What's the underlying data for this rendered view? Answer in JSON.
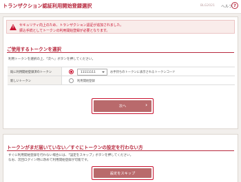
{
  "header": {
    "title": "トランザクション認証利用開始登録選択",
    "screen_id": "BLG2021",
    "help_label": "ヘルプ",
    "help_icon": "?"
  },
  "alert": {
    "icon": "!",
    "line1": "セキュリティ向上のため、トランザクション認証が追加されました。",
    "line2": "振込手続としてトークンの利用開始登録が必要となります。"
  },
  "select_token": {
    "title": "ご使用するトークンを選択",
    "instruction": "利用トークンを選択の上、「次へ」ボタンを押してください。",
    "rows": [
      {
        "label": "既に利用開始登録済のトークン",
        "select_value": "11111111",
        "note": "お手持ちのトークンに表示されるトークンコード",
        "checked": true
      },
      {
        "label": "新しいトークン",
        "option_label": "利用開始登録",
        "checked": false
      }
    ],
    "next_button": "次へ",
    "next_chevron": "›"
  },
  "no_token": {
    "title": "トークンがまだ届いていない／すぐにトークンの設定を行わない方",
    "instruction1": "すぐに利用開始登録を行わない場合には、「設定をスキップ」ボタンを押してください。",
    "instruction2": "なお、次回ログイン時に改めて利用開始登録が可能です。",
    "skip_button": "設定をスキップ"
  },
  "colors": {
    "brand": "#b7273c",
    "alert_text": "#c8102e",
    "button": "#b96a6c"
  }
}
